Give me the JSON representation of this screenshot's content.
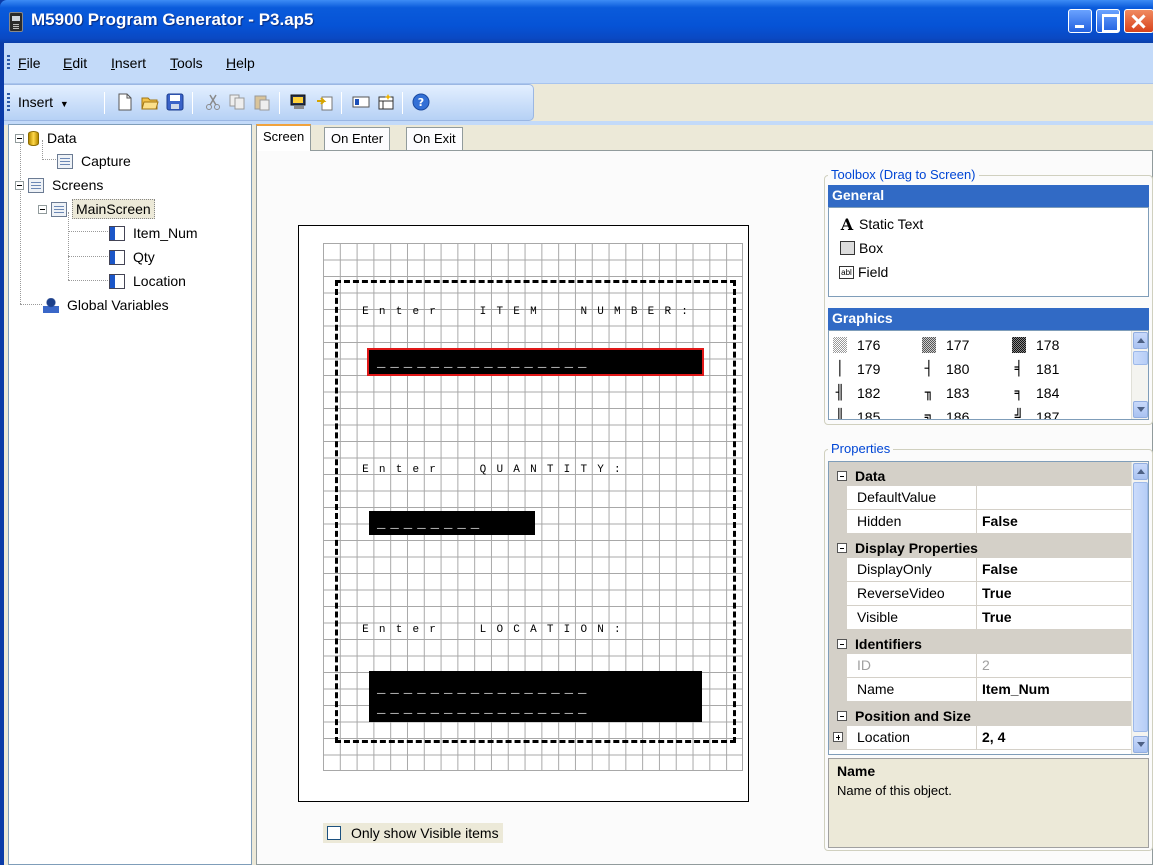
{
  "window": {
    "title": "M5900 Program Generator - P3.ap5"
  },
  "menu": {
    "items": [
      {
        "label": "File",
        "accel": "F",
        "rest": "ile"
      },
      {
        "label": "Edit",
        "accel": "E",
        "rest": "dit"
      },
      {
        "label": "Insert",
        "accel": "I",
        "rest": "nsert"
      },
      {
        "label": "Tools",
        "accel": "T",
        "rest": "ools"
      },
      {
        "label": "Help",
        "accel": "H",
        "rest": "elp"
      }
    ]
  },
  "toolbar": {
    "insert_label": "Insert",
    "icons": [
      "new-document-icon",
      "open-folder-icon",
      "save-icon",
      "cut-icon",
      "copy-icon",
      "paste-icon",
      "import-icon",
      "export-icon",
      "new-screen-icon",
      "new-record-icon",
      "help-icon"
    ]
  },
  "tree": {
    "data": "Data",
    "capture": "Capture",
    "screens": "Screens",
    "main_screen": "MainScreen",
    "item_num": "Item_Num",
    "qty": "Qty",
    "location": "Location",
    "global_vars": "Global Variables"
  },
  "tabs": [
    {
      "label": "Screen",
      "active": true
    },
    {
      "label": "On Enter",
      "active": false
    },
    {
      "label": "On Exit",
      "active": false
    }
  ],
  "screen": {
    "prompts": [
      {
        "text": "Enter  ITEM  NUMBER:"
      },
      {
        "text": "Enter  QUANTITY:"
      },
      {
        "text": "Enter  LOCATION:"
      }
    ],
    "fields": [
      {
        "name": "Item_Num",
        "text": "________________",
        "selected": true
      },
      {
        "name": "Qty",
        "text": "________",
        "selected": false
      },
      {
        "name": "Location",
        "text": "________________\n________________",
        "selected": false
      }
    ]
  },
  "only_visible_label": "Only show Visible items",
  "toolbox": {
    "title": "Toolbox (Drag to Screen)",
    "general_header": "General",
    "general_items": [
      {
        "icon": "static-text-icon",
        "label": "Static Text"
      },
      {
        "icon": "box-icon",
        "label": "Box"
      },
      {
        "icon": "field-icon",
        "label": "Field"
      }
    ],
    "graphics_header": "Graphics",
    "graphics_items": [
      "176",
      "177",
      "178",
      "179",
      "180",
      "181",
      "182",
      "183",
      "184",
      "185",
      "186",
      "187"
    ]
  },
  "properties": {
    "title": "Properties",
    "categories": {
      "data": "Data",
      "display": "Display Properties",
      "identifiers": "Identifiers",
      "position": "Position and Size"
    },
    "rows": {
      "default_value": {
        "name": "DefaultValue",
        "value": ""
      },
      "hidden": {
        "name": "Hidden",
        "value": "False"
      },
      "display_only": {
        "name": "DisplayOnly",
        "value": "False"
      },
      "reverse_video": {
        "name": "ReverseVideo",
        "value": "True"
      },
      "visible": {
        "name": "Visible",
        "value": "True"
      },
      "id": {
        "name": "ID",
        "value": "2"
      },
      "name": {
        "name": "Name",
        "value": "Item_Num"
      },
      "location": {
        "name": "Location",
        "value": "2, 4"
      }
    },
    "description_title": "Name",
    "description_text": "Name of this object."
  }
}
